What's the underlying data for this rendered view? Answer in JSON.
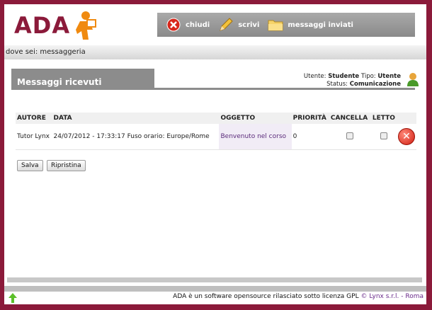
{
  "header": {
    "logo_text": "ADA",
    "toolbar": [
      {
        "label": "chiudi",
        "icon": "close-icon"
      },
      {
        "label": "scrivi",
        "icon": "pencil-icon"
      },
      {
        "label": "messaggi inviati",
        "icon": "folder-icon"
      }
    ]
  },
  "breadcrumb": "dove sei: messaggeria",
  "page": {
    "title": "Messaggi ricevuti",
    "user_label": "Utente:",
    "user_value": "Studente",
    "type_label": "Tipo:",
    "type_value": "Utente",
    "status_label": "Status:",
    "status_value": "Comunicazione"
  },
  "table": {
    "columns": [
      "AUTORE",
      "DATA",
      "OGGETTO",
      "PRIORITÀ",
      "CANCELLA",
      "LETTO"
    ],
    "rows": [
      {
        "author": "Tutor Lynx",
        "date": "24/07/2012 - 17:33:17 Fuso orario: Europe/Rome",
        "subject": "Benvenuto nel corso",
        "priority": "0"
      }
    ]
  },
  "buttons": {
    "save": "Salva",
    "reset": "Ripristina"
  },
  "footer": {
    "text": "ADA è un software opensource rilasciato sotto licenza GPL",
    "link": "© Lynx s.r.l. - Roma"
  }
}
